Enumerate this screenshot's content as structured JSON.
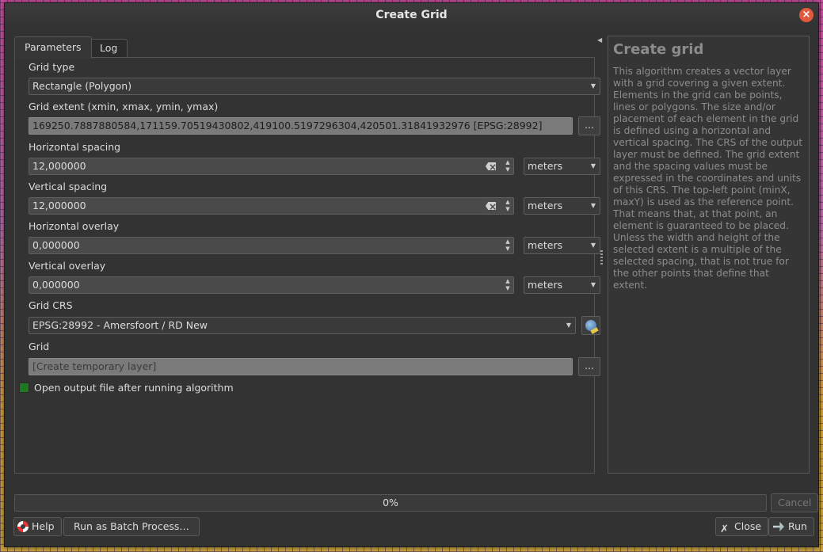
{
  "window": {
    "title": "Create Grid"
  },
  "tabs": [
    {
      "label": "Parameters",
      "active": true
    },
    {
      "label": "Log",
      "active": false
    }
  ],
  "params": {
    "grid_type_label": "Grid type",
    "grid_type_value": "Rectangle (Polygon)",
    "extent_label": "Grid extent (xmin, xmax, ymin, ymax)",
    "extent_value": "169250.7887880584,171159.70519430802,419100.5197296304,420501.31841932976 [EPSG:28992]",
    "h_spacing_label": "Horizontal spacing",
    "h_spacing_value": "12,000000",
    "h_spacing_unit": "meters",
    "v_spacing_label": "Vertical spacing",
    "v_spacing_value": "12,000000",
    "v_spacing_unit": "meters",
    "h_overlay_label": "Horizontal overlay",
    "h_overlay_value": "0,000000",
    "h_overlay_unit": "meters",
    "v_overlay_label": "Vertical overlay",
    "v_overlay_value": "0,000000",
    "v_overlay_unit": "meters",
    "crs_label": "Grid CRS",
    "crs_value": "EPSG:28992 - Amersfoort / RD New",
    "grid_label": "Grid",
    "grid_placeholder": "[Create temporary layer]",
    "open_output_label": "Open output file after running algorithm",
    "open_output_checked": true,
    "browse_label": "..."
  },
  "help": {
    "title": "Create grid",
    "text": "This algorithm creates a vector layer with a grid covering a given extent. Elements in the grid can be points, lines or polygons. The size and/or placement of each element in the grid is defined using a horizontal and vertical spacing. The CRS of the output layer must be defined. The grid extent and the spacing values must be expressed in the coordinates and units of this CRS. The top-left point (minX, maxY) is used as the reference point. That means that, at that point, an element is guaranteed to be placed. Unless the width and height of the selected extent is a multiple of the selected spacing, that is not true for the other points that define that extent."
  },
  "progress": {
    "text": "0%",
    "value": 0
  },
  "footer": {
    "cancel_label": "Cancel",
    "help_label": "Help",
    "batch_label": "Run as Batch Process…",
    "close_label": "Close",
    "run_label": "Run"
  },
  "colors": {
    "checkbox_checked": "#1e7a1e",
    "close_button": "#e25a3e"
  }
}
